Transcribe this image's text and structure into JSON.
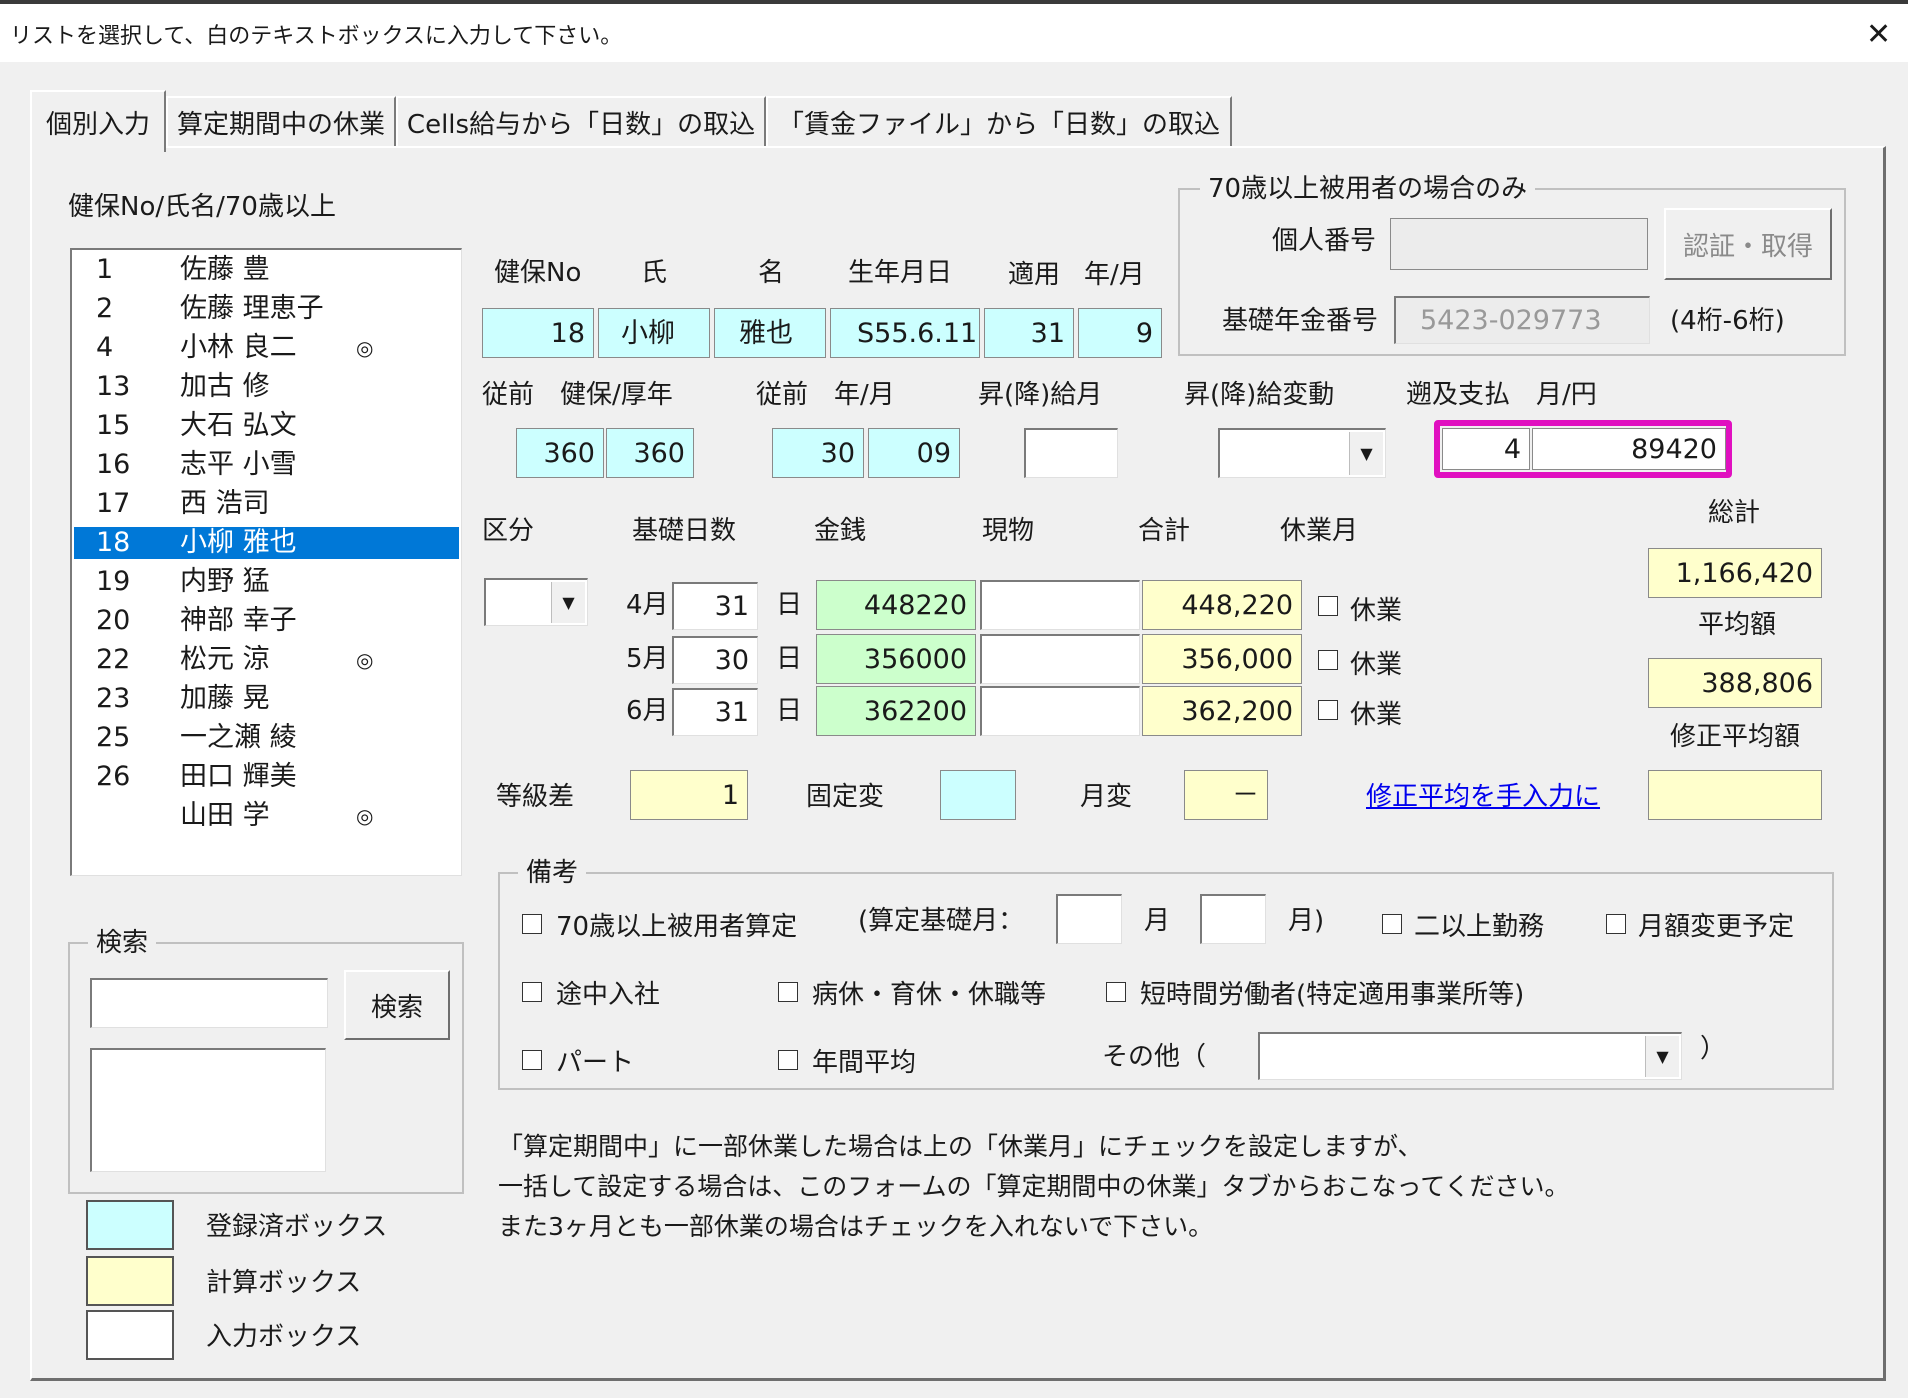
{
  "window": {
    "title": "リストを選択して、白のテキストボックスに入力して下さい。"
  },
  "tabs": [
    "個別入力",
    "算定期間中の休業",
    "Cells給与から「日数」の取込",
    "「賃金ファイル」から「日数」の取込"
  ],
  "list": {
    "label": "健保No/氏名/70歳以上",
    "items": [
      {
        "no": "1",
        "name": "佐藤 豊",
        "mark": ""
      },
      {
        "no": "2",
        "name": "佐藤 理恵子",
        "mark": ""
      },
      {
        "no": "4",
        "name": "小林 良二",
        "mark": "◎"
      },
      {
        "no": "13",
        "name": "加古 修",
        "mark": ""
      },
      {
        "no": "15",
        "name": "大石 弘文",
        "mark": ""
      },
      {
        "no": "16",
        "name": "志平 小雪",
        "mark": ""
      },
      {
        "no": "17",
        "name": "西 浩司",
        "mark": ""
      },
      {
        "no": "18",
        "name": "小柳 雅也",
        "mark": "",
        "selected": true
      },
      {
        "no": "19",
        "name": "内野 猛",
        "mark": ""
      },
      {
        "no": "20",
        "name": "神部 幸子",
        "mark": ""
      },
      {
        "no": "22",
        "name": "松元 涼",
        "mark": "◎"
      },
      {
        "no": "23",
        "name": "加藤 晃",
        "mark": ""
      },
      {
        "no": "25",
        "name": "一之瀬 綾",
        "mark": ""
      },
      {
        "no": "26",
        "name": "田口 輝美",
        "mark": ""
      },
      {
        "no": "",
        "name": "山田 学",
        "mark": "◎"
      }
    ]
  },
  "search": {
    "group_label": "検索",
    "button_label": "検索",
    "input_value": ""
  },
  "legend": [
    {
      "label": "登録済ボックス",
      "color": "#ccffff"
    },
    {
      "label": "計算ボックス",
      "color": "#ffffcc"
    },
    {
      "label": "入力ボックス",
      "color": "#ffffff"
    }
  ],
  "employee": {
    "headers": {
      "kenpo_no": "健保No",
      "shi": "氏",
      "mei": "名",
      "birth": "生年月日",
      "tekiyo": "適用",
      "nengetsu": "年/月"
    },
    "kenpo_no": "18",
    "shi": "小柳",
    "mei": "雅也",
    "birth": "S55.6.11",
    "tekiyo_year": "31",
    "tekiyo_month": "9"
  },
  "senior": {
    "group_label": "70歳以上被用者の場合のみ",
    "kojin_label": "個人番号",
    "kojin_value": "",
    "auth_button": "認証・取得",
    "nenkin_label": "基礎年金番号",
    "nenkin_value": "5423-029773",
    "nenkin_hint": "(4桁-6桁)"
  },
  "previous": {
    "hoken_label": "従前　健保/厚年",
    "kenpo": "360",
    "kounen": "360",
    "ym_label": "従前　年/月",
    "year": "30",
    "month": "09",
    "shokyu_label": "昇(降)給月",
    "shokyu_value": "",
    "hendo_label": "昇(降)給変動",
    "hendo_value": "",
    "sokyu_label": "遡及支払　月/円",
    "sokyu_month": "4",
    "sokyu_yen": "89420"
  },
  "accent_color": "#e010c0",
  "monthly": {
    "headers": {
      "kubun": "区分",
      "kiso": "基礎日数",
      "kinsen": "金銭",
      "genbutsu": "現物",
      "gokei": "合計",
      "kyugyo": "休業月"
    },
    "kubun_value": "",
    "day_unit": "日",
    "kyugyo_label": "休業",
    "rows": [
      {
        "month": "4月",
        "days": "31",
        "kinsen": "448220",
        "genbutsu": "",
        "gokei": "448,220"
      },
      {
        "month": "5月",
        "days": "30",
        "kinsen": "356000",
        "genbutsu": "",
        "gokei": "356,000"
      },
      {
        "month": "6月",
        "days": "31",
        "kinsen": "362200",
        "genbutsu": "",
        "gokei": "362,200"
      }
    ]
  },
  "totals": {
    "sokei_label": "総計",
    "sokei": "1,166,420",
    "heikin_label": "平均額",
    "heikin": "388,806",
    "shusei_label": "修正平均額",
    "shusei": ""
  },
  "grades": {
    "tokyu_label": "等級差",
    "tokyu": "1",
    "kotei_label": "固定変",
    "kotei": "",
    "getsuhen_label": "月変",
    "getsuhen": "－",
    "manual_link": "修正平均を手入力に"
  },
  "remarks": {
    "group_label": "備考",
    "senior_calc": "70歳以上被用者算定",
    "kiso_open": "(算定基礎月：",
    "tsuki1": "月",
    "tsuki2": "月)",
    "multi": "二以上勤務",
    "change": "月額変更予定",
    "tochu": "途中入社",
    "byokyu": "病休・育休・休職等",
    "tanjikan": "短時間労働者(特定適用事業所等)",
    "part": "パート",
    "nenkan": "年間平均",
    "sonota": "その他（",
    "close_paren": "）"
  },
  "notes": [
    "「算定期間中」に一部休業した場合は上の「休業月」にチェックを設定しますが、",
    "一括して設定する場合は、このフォームの「算定期間中の休業」タブからおこなってください。",
    "また3ヶ月とも一部休業の場合はチェックを入れないで下さい。"
  ]
}
